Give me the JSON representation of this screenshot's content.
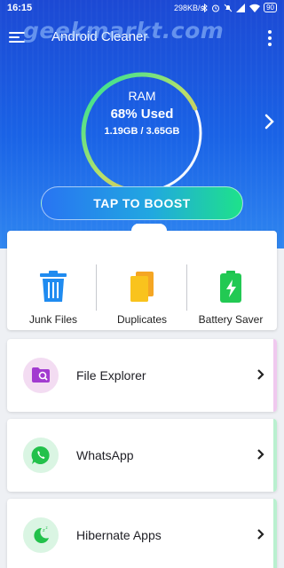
{
  "status_bar": {
    "time": "16:15",
    "network_speed": "298KB/s",
    "battery": "90"
  },
  "watermark": "geekmarkt.com",
  "app_bar": {
    "title": "Android Cleaner"
  },
  "ram": {
    "label": "RAM",
    "used_text": "68% Used",
    "size_text": "1.19GB / 3.65GB",
    "used_fraction": 0.68
  },
  "boost_button": {
    "label": "TAP TO BOOST"
  },
  "tools": [
    {
      "label": "Junk Files",
      "icon": "trash-icon"
    },
    {
      "label": "Duplicates",
      "icon": "files-icon"
    },
    {
      "label": "Battery Saver",
      "icon": "battery-icon"
    }
  ],
  "list": [
    {
      "label": "File Explorer",
      "icon": "folder-search-icon",
      "accent": "#f0c8ef",
      "circle": "#f3dcf2"
    },
    {
      "label": "WhatsApp",
      "icon": "whatsapp-icon",
      "accent": "#b9f0cf",
      "circle": "#daf5e3"
    },
    {
      "label": "Hibernate Apps",
      "icon": "moon-icon",
      "accent": "#b9f0cf",
      "circle": "#daf5e3"
    }
  ],
  "colors": {
    "primary": "#1a54dc",
    "boost_start": "#2874f2",
    "boost_end": "#1ee28a"
  }
}
